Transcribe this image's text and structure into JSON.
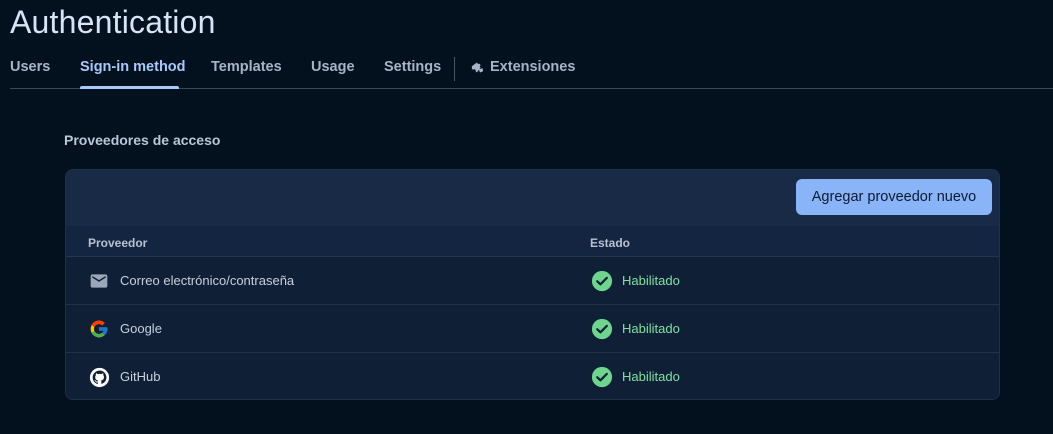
{
  "page": {
    "title": "Authentication"
  },
  "tabs": [
    {
      "label": "Users",
      "active": false
    },
    {
      "label": "Sign-in method",
      "active": true
    },
    {
      "label": "Templates",
      "active": false
    },
    {
      "label": "Usage",
      "active": false
    },
    {
      "label": "Settings",
      "active": false
    },
    {
      "label": "Extensiones",
      "active": false,
      "icon": "extensions-icon"
    }
  ],
  "section": {
    "label": "Proveedores de acceso"
  },
  "toolbar": {
    "add_label": "Agregar proveedor nuevo"
  },
  "table": {
    "headers": {
      "provider": "Proveedor",
      "status": "Estado"
    },
    "rows": [
      {
        "provider": "Correo electrónico/contraseña",
        "icon": "email-icon",
        "status": "Habilitado"
      },
      {
        "provider": "Google",
        "icon": "google-icon",
        "status": "Habilitado"
      },
      {
        "provider": "GitHub",
        "icon": "github-icon",
        "status": "Habilitado"
      }
    ]
  },
  "colors": {
    "accent": "#a8c7fa",
    "button": "#8ab4f8",
    "enabled": "#7fe3a2",
    "background": "#03111f"
  }
}
